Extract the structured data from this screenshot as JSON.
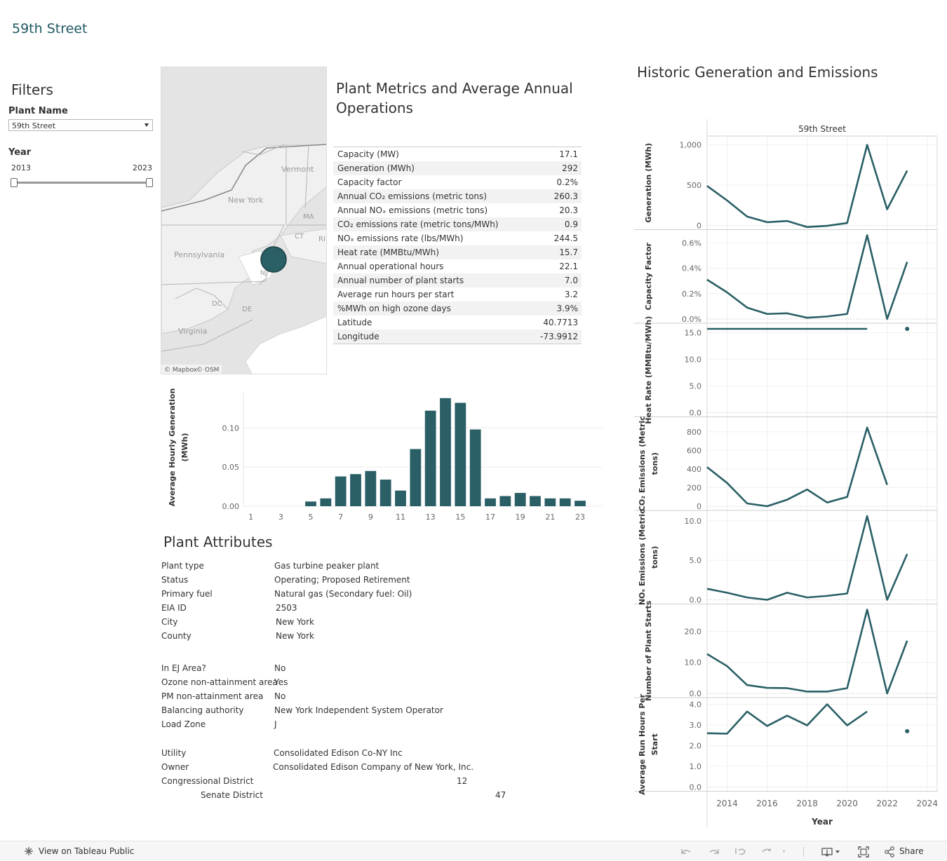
{
  "title": "59th Street",
  "filters": {
    "heading": "Filters",
    "plant_label": "Plant Name",
    "plant_value": "59th Street",
    "year_label": "Year",
    "year_min": "2013",
    "year_max": "2023"
  },
  "map": {
    "attribution_mapbox": "© Mapbox",
    "attribution_osm": "© OSM",
    "labels": [
      "Vermont",
      "New York",
      "MA",
      "CT",
      "RI",
      "Pennsylvania",
      "NJ",
      "DC",
      "DE",
      "Virginia"
    ]
  },
  "metrics": {
    "heading": "Plant Metrics and Average Annual Operations",
    "rows": [
      {
        "label": "Capacity (MW)",
        "value": "17.1"
      },
      {
        "label": "Generation (MWh)",
        "value": "292"
      },
      {
        "label": "Capacity factor",
        "value": "0.2%"
      },
      {
        "label": "Annual CO₂ emissions (metric tons)",
        "value": "260.3"
      },
      {
        "label": "Annual NOₓ emissions (metric tons)",
        "value": "20.3"
      },
      {
        "label": "CO₂ emissions rate (metric tons/MWh)",
        "value": "0.9"
      },
      {
        "label": "NOₓ emissions rate (lbs/MWh)",
        "value": "244.5"
      },
      {
        "label": "Heat rate (MMBtu/MWh)",
        "value": "15.7"
      },
      {
        "label": "Annual operational hours",
        "value": "22.1"
      },
      {
        "label": "Annual number of plant starts",
        "value": "7.0"
      },
      {
        "label": "Average run hours per start",
        "value": "3.2"
      },
      {
        "label": "%MWh on high ozone days",
        "value": "3.9%"
      },
      {
        "label": "Latitude",
        "value": "40.7713"
      },
      {
        "label": "Longitude",
        "value": "-73.9912"
      }
    ]
  },
  "attributes": {
    "heading": "Plant Attributes",
    "group1": [
      {
        "label": "Plant type",
        "value": "Gas turbine peaker plant"
      },
      {
        "label": "Status",
        "value": "Operating; Proposed Retirement"
      },
      {
        "label": "Primary fuel",
        "value": "Natural gas (Secondary fuel: Oil)"
      },
      {
        "label": "EIA ID",
        "value": "2503"
      },
      {
        "label": "City",
        "value": "New York"
      },
      {
        "label": "County",
        "value": "New York"
      }
    ],
    "group2": [
      {
        "label": "In EJ Area?",
        "value": "No"
      },
      {
        "label": "Ozone non-attainment area",
        "value": "Yes"
      },
      {
        "label": "PM non-attainment area",
        "value": "No"
      },
      {
        "label": "Balancing authority",
        "value": "New York Independent System Operator"
      },
      {
        "label": "Load Zone",
        "value": "J"
      }
    ],
    "group3": [
      {
        "label": "Utility",
        "value": "Consolidated Edison Co-NY Inc"
      },
      {
        "label": "Owner",
        "value": "Consolidated Edison Company of New York, Inc."
      },
      {
        "label": "Congressional District",
        "value": "12"
      },
      {
        "label": "Senate District",
        "value": "47"
      }
    ]
  },
  "historic": {
    "heading": "Historic Generation and Emissions",
    "column_header": "59th Street",
    "xlabel": "Year"
  },
  "footer": {
    "view_label": "View on Tableau Public",
    "share_label": "Share"
  },
  "colors": {
    "accent": "#2a5f66",
    "title": "#1f5a62"
  },
  "chart_data": [
    {
      "type": "bar",
      "ylabel": "Average Hourly Generation (MWh)",
      "xlabel": "",
      "categories": [
        1,
        2,
        3,
        4,
        5,
        6,
        7,
        8,
        9,
        10,
        11,
        12,
        13,
        14,
        15,
        16,
        17,
        18,
        19,
        20,
        21,
        22,
        23,
        24
      ],
      "values": [
        0,
        0,
        0,
        0,
        0.006,
        0.01,
        0.038,
        0.041,
        0.045,
        0.034,
        0.02,
        0.073,
        0.122,
        0.138,
        0.132,
        0.098,
        0.01,
        0.013,
        0.017,
        0.013,
        0.01,
        0.01,
        0.007,
        0
      ],
      "x_ticks": [
        1,
        3,
        5,
        7,
        9,
        11,
        13,
        15,
        17,
        19,
        21,
        23
      ],
      "y_ticks": [
        "0.00",
        "0.05",
        "0.10"
      ],
      "ylim": [
        0,
        0.145
      ],
      "grid": true
    },
    {
      "type": "line",
      "x": [
        2013,
        2014,
        2015,
        2016,
        2017,
        2018,
        2019,
        2020,
        2021,
        2022,
        2023
      ],
      "x_ticks": [
        "2014",
        "2016",
        "2018",
        "2020",
        "2022",
        "2024"
      ],
      "xlim": [
        2013,
        2024.5
      ],
      "panels": [
        {
          "ylabel": "Generation (MWh)",
          "ylim": [
            0,
            1040
          ],
          "y_ticks": [
            {
              "v": 0,
              "t": "0"
            },
            {
              "v": 500,
              "t": "500"
            },
            {
              "v": 1000,
              "t": "1,000"
            }
          ],
          "values": [
            490,
            310,
            110,
            40,
            55,
            -20,
            -5,
            30,
            1000,
            200,
            680
          ]
        },
        {
          "ylabel": "Capacity Factor",
          "ylim": [
            0,
            0.0066
          ],
          "y_ticks": [
            {
              "v": 0,
              "t": "0.0%"
            },
            {
              "v": 0.002,
              "t": "0.2%"
            },
            {
              "v": 0.004,
              "t": "0.4%"
            },
            {
              "v": 0.006,
              "t": "0.6%"
            }
          ],
          "values": [
            0.0031,
            0.0021,
            0.0009,
            0.0004,
            0.00045,
            0.0001,
            0.0002,
            0.0004,
            0.0066,
            0.0,
            0.0045
          ]
        },
        {
          "ylabel": "Heat Rate (MMBtu/MWh)",
          "ylim": [
            0,
            15.7
          ],
          "y_ticks": [
            {
              "v": 0,
              "t": "0.0"
            },
            {
              "v": 5,
              "t": "5.0"
            },
            {
              "v": 10,
              "t": "10.0"
            },
            {
              "v": 15,
              "t": "15.0"
            }
          ],
          "values": [
            15.7,
            15.7,
            15.7,
            15.7,
            15.7,
            15.7,
            15.7,
            15.7,
            15.7,
            null,
            15.7
          ]
        },
        {
          "ylabel": "CO₂ Emissions (Metric tons)",
          "ylim": [
            0,
            900
          ],
          "y_ticks": [
            {
              "v": 0,
              "t": "0"
            },
            {
              "v": 200,
              "t": "200"
            },
            {
              "v": 400,
              "t": "400"
            },
            {
              "v": 600,
              "t": "600"
            },
            {
              "v": 800,
              "t": "800"
            }
          ],
          "values": [
            420,
            250,
            30,
            0,
            70,
            180,
            40,
            100,
            845,
            230,
            null
          ]
        },
        {
          "ylabel": "NOₓ Emissions (Metric tons)",
          "ylim": [
            0,
            10.6
          ],
          "y_ticks": [
            {
              "v": 0,
              "t": "0.0"
            },
            {
              "v": 5,
              "t": "5.0"
            },
            {
              "v": 10,
              "t": "10.0"
            }
          ],
          "values": [
            1.4,
            0.9,
            0.3,
            0.0,
            0.9,
            0.3,
            0.5,
            0.8,
            10.6,
            0.0,
            5.8
          ]
        },
        {
          "ylabel": "Number of Plant Starts",
          "ylim": [
            0,
            27
          ],
          "y_ticks": [
            {
              "v": 0,
              "t": "0.0"
            },
            {
              "v": 10,
              "t": "10.0"
            },
            {
              "v": 20,
              "t": "20.0"
            }
          ],
          "values": [
            12.7,
            8.8,
            2.7,
            1.8,
            1.7,
            0.6,
            0.6,
            1.7,
            27,
            0.0,
            17
          ]
        },
        {
          "ylabel": "Average Run Hours Per Start",
          "ylim": [
            0,
            4.05
          ],
          "y_ticks": [
            {
              "v": 0,
              "t": "0.0"
            },
            {
              "v": 1,
              "t": "1.0"
            },
            {
              "v": 2,
              "t": "2.0"
            },
            {
              "v": 3,
              "t": "3.0"
            },
            {
              "v": 4,
              "t": "4.0"
            }
          ],
          "values": [
            2.6,
            2.58,
            3.65,
            2.95,
            3.45,
            2.98,
            4.0,
            2.98,
            3.65,
            null,
            2.7
          ]
        }
      ]
    }
  ]
}
